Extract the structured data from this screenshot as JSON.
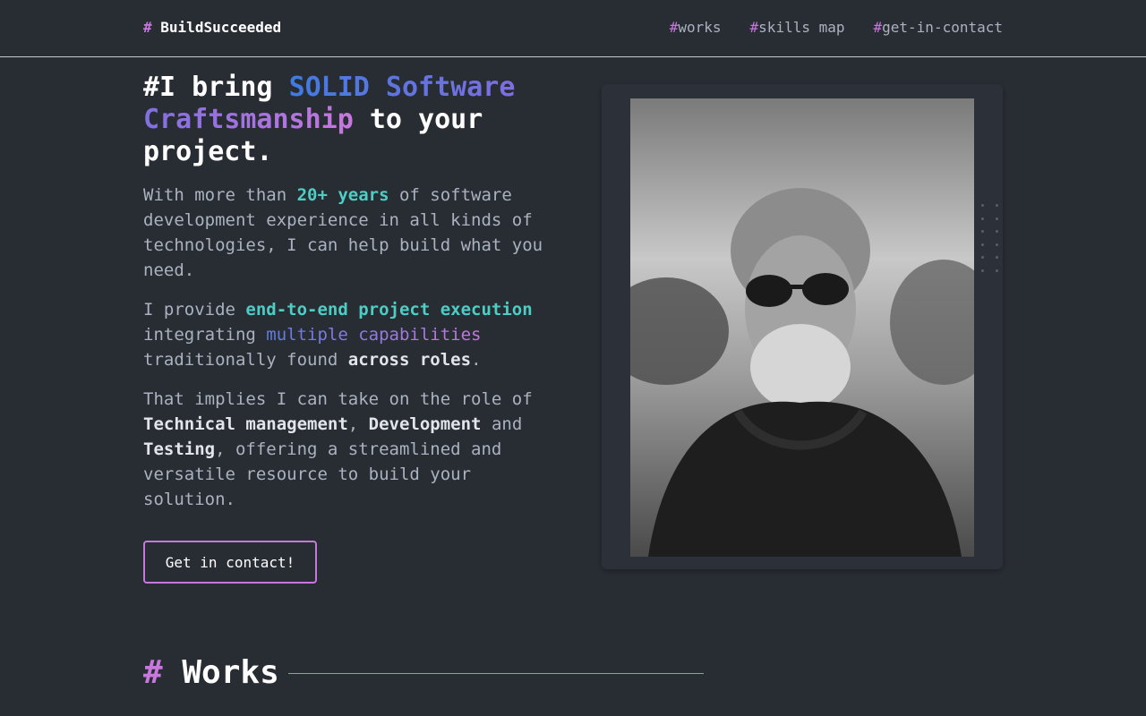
{
  "header": {
    "logo_hash": "#",
    "logo_text": "BuildSucceeded",
    "nav": [
      {
        "hash": "#",
        "label": "works"
      },
      {
        "hash": "#",
        "label": "skills map"
      },
      {
        "hash": "#",
        "label": "get-in-contact"
      }
    ]
  },
  "hero": {
    "title_prefix": "#I bring ",
    "title_highlight": "SOLID Software Craftsmanship",
    "title_suffix": " to your project.",
    "p1": {
      "a": "With more than ",
      "b": "20+ years",
      "c": " of software development experience in all kinds of technologies, I can help build what you need."
    },
    "p2": {
      "a": "I provide ",
      "b": "end-to-end project execution",
      "c": " integrating ",
      "d": "multiple capabilities",
      "e": " traditionally found ",
      "f": "across roles",
      "g": "."
    },
    "p3": {
      "a": "That implies I can take on the role of ",
      "b": "Technical management",
      "c": ", ",
      "d": "Development",
      "e": " and ",
      "f": "Testing",
      "g": ", offering a streamlined and versatile resource to build your solution."
    },
    "cta_label": "Get in contact!"
  },
  "photo": {
    "alt": "portrait"
  },
  "works": {
    "hash": "#",
    "title": "Works"
  },
  "colors": {
    "background": "#282c33",
    "accent": "#c778dd",
    "teal": "#4ecdc4",
    "blue": "#3f7be0"
  }
}
